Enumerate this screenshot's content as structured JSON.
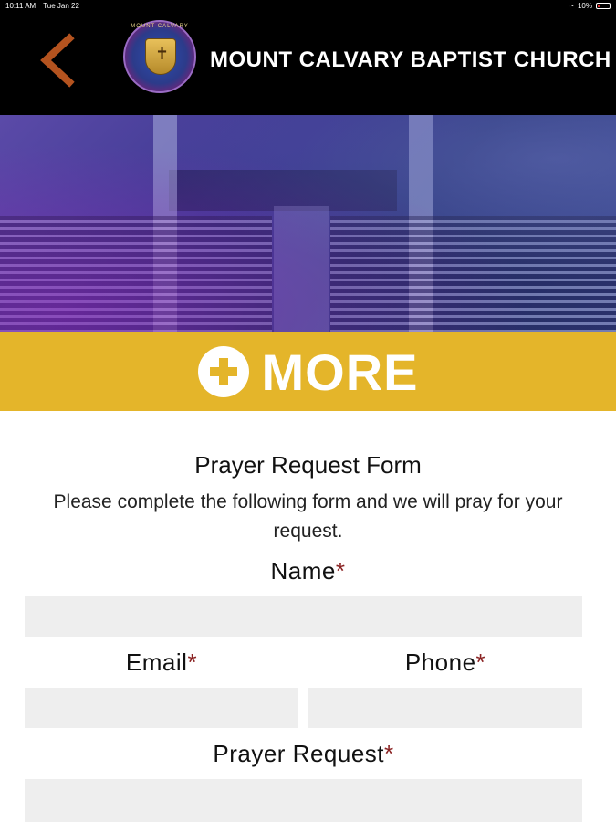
{
  "status_bar": {
    "time": "10:11 AM",
    "date": "Tue Jan 22",
    "battery": "10%"
  },
  "header": {
    "title": "MOUNT CALVARY BAPTIST CHURCH",
    "logo_text": "MOUNT CALVARY",
    "back_icon": "chevron-left-icon"
  },
  "banner": {
    "label": "MORE",
    "icon": "plus-circle-icon",
    "color": "#e4b52a"
  },
  "form": {
    "title": "Prayer Request Form",
    "description": "Please complete the following form and we will pray for your request.",
    "required_marker": "*",
    "name_label": "Name",
    "email_label": "Email",
    "phone_label": "Phone",
    "prayer_label": "Prayer Request"
  }
}
